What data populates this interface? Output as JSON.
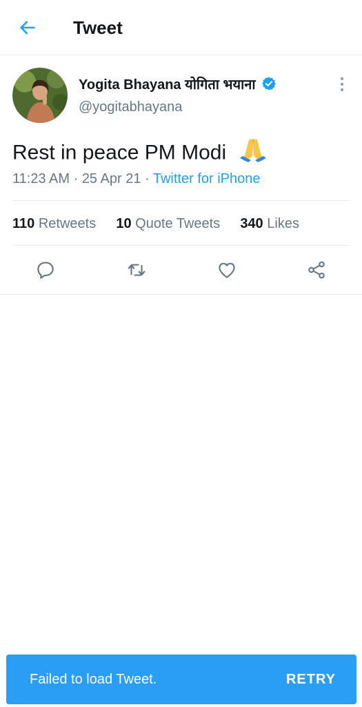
{
  "header": {
    "title": "Tweet"
  },
  "author": {
    "name": "Yogita Bhayana योगिता भयाना",
    "handle": "@yogitabhayana"
  },
  "tweet": {
    "text": "Rest in peace PM Modi",
    "emoji": "folded-hands",
    "time": "11:23 AM",
    "date": "25 Apr 21",
    "source": "Twitter for iPhone"
  },
  "stats": {
    "retweets_count": "110",
    "retweets_label": "Retweets",
    "quotes_count": "10",
    "quotes_label": "Quote Tweets",
    "likes_count": "340",
    "likes_label": "Likes"
  },
  "actions": [
    "reply-icon",
    "retweet-icon",
    "like-icon",
    "share-icon"
  ],
  "toast": {
    "message": "Failed to load Tweet.",
    "action": "RETRY"
  },
  "colors": {
    "accent": "#1da1f2",
    "toast_bg": "#2a9df4",
    "secondary_text": "#657786"
  }
}
